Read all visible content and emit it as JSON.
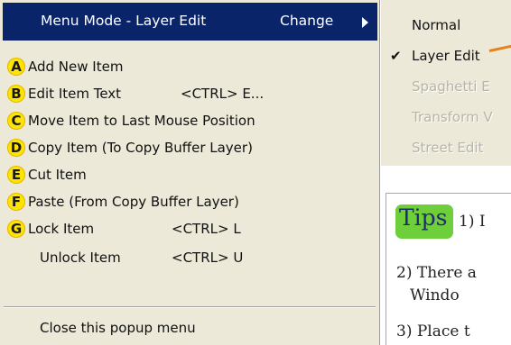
{
  "menu": {
    "header_title": "Menu Mode - Layer Edit",
    "header_change": "Change",
    "items": [
      {
        "letter": "A",
        "label": "Add New Item",
        "shortcut": ""
      },
      {
        "letter": "B",
        "label": "Edit Item Text",
        "shortcut": "<CTRL> E..."
      },
      {
        "letter": "C",
        "label": "Move Item to Last Mouse Position",
        "shortcut": ""
      },
      {
        "letter": "D",
        "label": "Copy Item (To Copy Buffer Layer)",
        "shortcut": ""
      },
      {
        "letter": "E",
        "label": "Cut Item",
        "shortcut": ""
      },
      {
        "letter": "F",
        "label": "Paste (From Copy Buffer Layer)",
        "shortcut": ""
      },
      {
        "letter": "G",
        "label": "Lock Item",
        "shortcut": "<CTRL> L"
      },
      {
        "letter": "",
        "label": "Unlock Item",
        "shortcut": "<CTRL> U"
      }
    ],
    "close_label": "Close this popup menu"
  },
  "submenu": {
    "items": [
      {
        "label": "Normal",
        "checked": false,
        "disabled": false
      },
      {
        "label": "Layer Edit",
        "checked": true,
        "disabled": false
      },
      {
        "label": "Spaghetti E",
        "checked": false,
        "disabled": true
      },
      {
        "label": "Transform V",
        "checked": false,
        "disabled": true
      },
      {
        "label": "Street Edit",
        "checked": false,
        "disabled": true
      }
    ],
    "check_glyph": "✔"
  },
  "tips": {
    "title": "Tips",
    "line1": "1) I",
    "line2": "2) There a",
    "line3": "Windo",
    "line4": "3) Place t"
  },
  "colors": {
    "menu_bg": "#ece9d8",
    "header_bg": "#0a246a",
    "badge_yellow": "#ffe400",
    "tips_green": "#6fcf3a",
    "arrow_orange": "#e8821e"
  }
}
